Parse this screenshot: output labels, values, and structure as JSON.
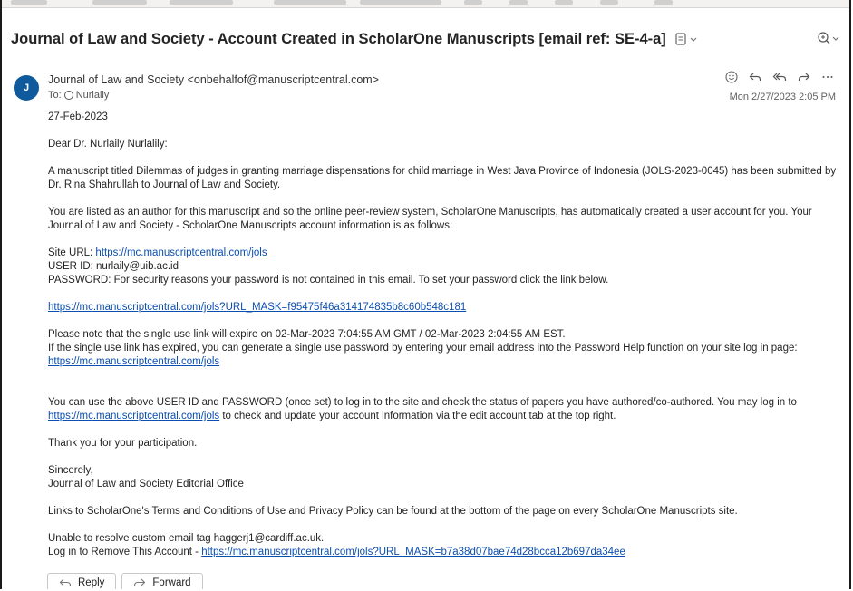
{
  "email": {
    "subject": "Journal of Law and Society - Account Created in ScholarOne Manuscripts [email ref: SE-4-a]",
    "avatar_initial": "J",
    "sender": "Journal of Law and Society <onbehalfof@manuscriptcentral.com>",
    "to_label": "To:",
    "to_name": "Nurlaily",
    "datetime": "Mon 2/27/2023 2:05 PM"
  },
  "body": {
    "date": "27-Feb-2023",
    "greeting": "Dear Dr. Nurlaily Nurlalily:",
    "para1": "A manuscript titled Dilemmas of judges in granting marriage dispensations for child marriage in West Java Province of Indonesia (JOLS-2023-0045) has been submitted by Dr. Rina Shahrullah to Journal of Law and Society.",
    "para2": "You are listed as an author for this manuscript and so the online peer-review system, ScholarOne Manuscripts, has automatically created a user account for you. Your Journal of Law and Society - ScholarOne Manuscripts account information is as follows:",
    "site_label": "Site URL: ",
    "site_url": "https://mc.manuscriptcentral.com/jols",
    "user_id_line": "USER ID:  nurlaily@uib.ac.id",
    "password_line": "PASSWORD:  For security reasons your password is not contained in this email. To set your password click the link below.",
    "password_link": "https://mc.manuscriptcentral.com/jols?URL_MASK=f95475f46a314174835b8c60b548c181",
    "expire_line": "Please note that the single use link will expire on 02-Mar-2023 7:04:55 AM GMT / 02-Mar-2023 2:04:55 AM EST.",
    "expired_line": "If the single use link has expired, you can generate a single use password by entering your email address into the Password Help function on your site log in page:",
    "help_link": "https://mc.manuscriptcentral.com/jols",
    "login_line1": "You can use the above USER ID and PASSWORD (once set) to log in to the site and check the status of papers you have authored/co-authored.  You may log in to",
    "login_link": "https://mc.manuscriptcentral.com/jols",
    "login_line2": " to check and update your account information via the edit account tab at the top right.",
    "thanks": "Thank you for your participation.",
    "sincerely": "Sincerely,",
    "office": "Journal of Law and Society Editorial Office",
    "terms": "Links to ScholarOne's Terms and Conditions of Use and Privacy Policy can be found at the bottom of the page on every ScholarOne Manuscripts site.",
    "unable": "Unable to resolve custom email tag haggerj1@cardiff.ac.uk.",
    "remove_label": "Log in to Remove This Account - ",
    "remove_link": "https://mc.manuscriptcentral.com/jols?URL_MASK=b7a38d07bae74d28bcca12b697da34ee"
  },
  "buttons": {
    "reply": "Reply",
    "forward": "Forward"
  }
}
